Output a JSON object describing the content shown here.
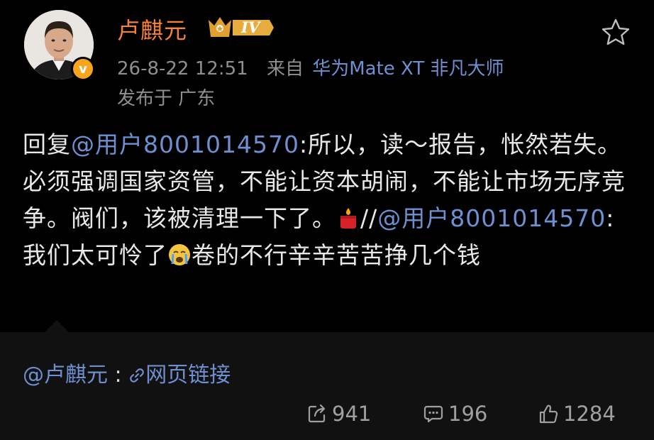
{
  "post": {
    "username": "卢麒元",
    "level": "IV",
    "verified_mark": "v",
    "timestamp": "26-8-22 12:51",
    "source_prefix": "来自",
    "source": "华为Mate XT 非凡大师",
    "location": "发布于 广东",
    "content": {
      "reply_prefix": "回复",
      "mention1": "@用户8001014570",
      "text1": ":所以，读～报告，怅然若失。必须强调国家资管，不能让资本胡闹，不能让市场无序竞争。阀们，该被清理一下了。",
      "text2": "//",
      "mention2": "@用户8001014570",
      "text3": ":我们太可怜了",
      "text4": "卷的不行辛辛苦苦挣几个钱"
    }
  },
  "quote": {
    "author": "@卢麒元",
    "separator": ":",
    "link_text": "网页链接"
  },
  "stats": {
    "reposts": "941",
    "comments": "196",
    "likes": "1284"
  },
  "icons": {
    "favorite": "star-outline-icon",
    "emoji1": "candle-emoji-icon",
    "emoji2": "crying-face-emoji-icon",
    "link": "link-icon",
    "repost": "repost-icon",
    "comment": "comment-icon",
    "like": "thumbs-up-icon"
  },
  "colors": {
    "background": "#000000",
    "username": "#f5803a",
    "mention": "#6e8fd0",
    "meta": "#8f8f8f",
    "quote_bg": "#111111",
    "badge": "#f7a51d"
  }
}
